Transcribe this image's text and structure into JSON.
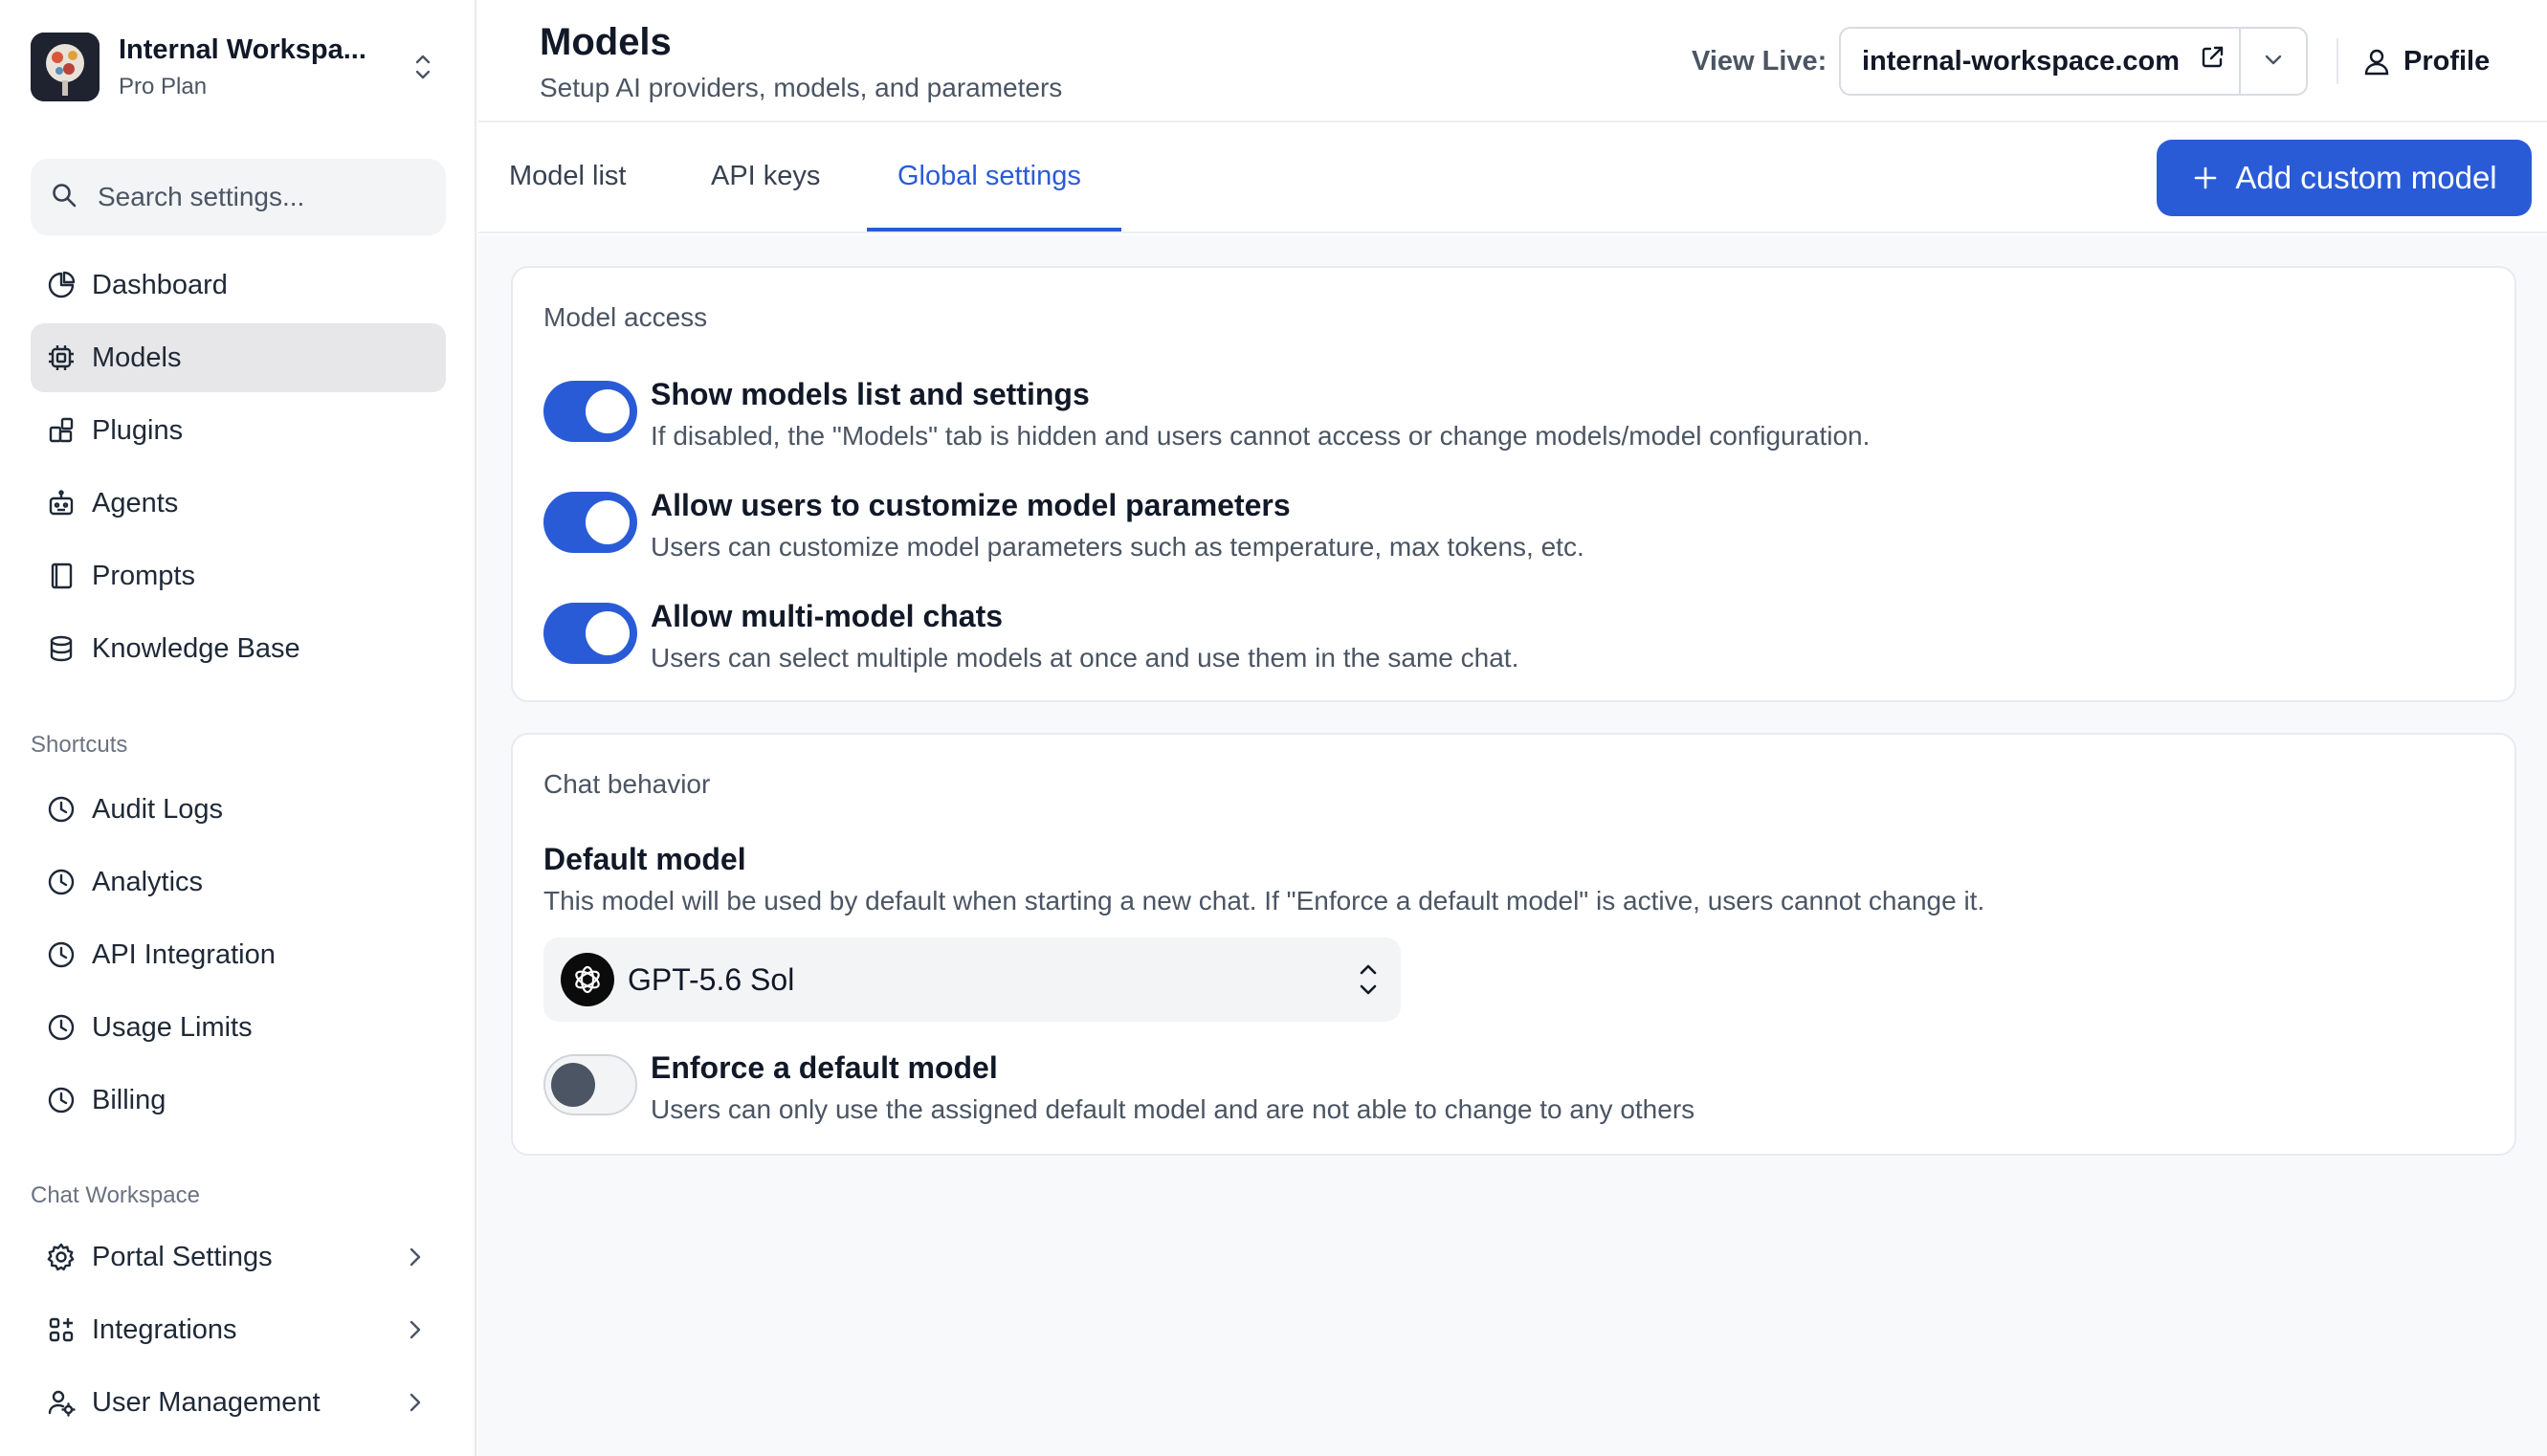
{
  "workspace": {
    "name": "Internal Workspa...",
    "plan": "Pro Plan"
  },
  "search": {
    "placeholder": "Search settings..."
  },
  "sidebar": {
    "items": [
      {
        "label": "Dashboard",
        "icon": "pie-chart-icon"
      },
      {
        "label": "Models",
        "icon": "cpu-icon",
        "active": true
      },
      {
        "label": "Plugins",
        "icon": "puzzle-icon"
      },
      {
        "label": "Agents",
        "icon": "robot-icon"
      },
      {
        "label": "Prompts",
        "icon": "notebook-icon"
      },
      {
        "label": "Knowledge Base",
        "icon": "database-icon"
      }
    ],
    "shortcuts_title": "Shortcuts",
    "shortcuts": [
      {
        "label": "Audit Logs",
        "icon": "clock-icon"
      },
      {
        "label": "Analytics",
        "icon": "clock-icon"
      },
      {
        "label": "API Integration",
        "icon": "clock-icon"
      },
      {
        "label": "Usage Limits",
        "icon": "clock-icon"
      },
      {
        "label": "Billing",
        "icon": "clock-icon"
      }
    ],
    "chat_workspace_title": "Chat Workspace",
    "chat_workspace": [
      {
        "label": "Portal Settings",
        "icon": "gear-icon"
      },
      {
        "label": "Integrations",
        "icon": "apps-icon"
      },
      {
        "label": "User Management",
        "icon": "users-gear-icon"
      }
    ]
  },
  "header": {
    "title": "Models",
    "subtitle": "Setup AI providers, models, and parameters",
    "view_live_label": "View Live:",
    "view_live_url": "internal-workspace.com",
    "profile_label": "Profile"
  },
  "tabs": [
    {
      "label": "Model list"
    },
    {
      "label": "API keys"
    },
    {
      "label": "Global settings",
      "active": true
    }
  ],
  "add_button_label": "Add custom model",
  "model_access": {
    "title": "Model access",
    "rows": [
      {
        "title": "Show models list and settings",
        "desc": "If disabled, the \"Models\" tab is hidden and users cannot access or change models/model configuration.",
        "enabled": true
      },
      {
        "title": "Allow users to customize model parameters",
        "desc": "Users can customize model parameters such as temperature, max tokens, etc.",
        "enabled": true
      },
      {
        "title": "Allow multi-model chats",
        "desc": "Users can select multiple models at once and use them in the same chat.",
        "enabled": true
      }
    ]
  },
  "chat_behavior": {
    "title": "Chat behavior",
    "default_model_title": "Default model",
    "default_model_desc": "This model will be used by default when starting a new chat. If \"Enforce a default model\" is active, users cannot change it.",
    "selected_model": "GPT-5.6 Sol",
    "enforce_title": "Enforce a default model",
    "enforce_desc": "Users can only use the assigned default model and are not able to change to any others",
    "enforce_enabled": false
  },
  "colors": {
    "accent": "#2a5bd7",
    "active_nav_bg": "#e7e7e9"
  }
}
